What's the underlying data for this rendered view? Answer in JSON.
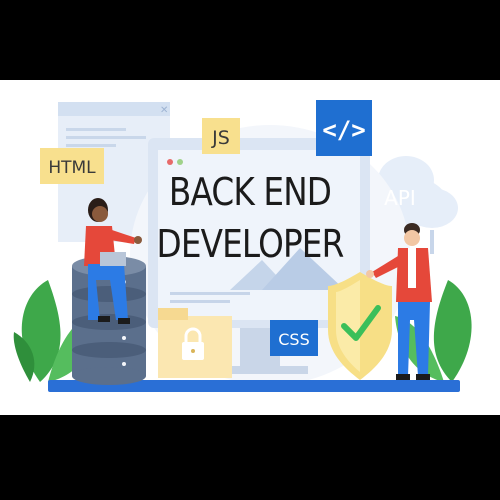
{
  "title": {
    "line1": "BACK END",
    "line2": "DEVELOPER"
  },
  "tags": {
    "html": "HTML",
    "js": "JS",
    "code": "</>",
    "api": "API",
    "css": "CSS"
  },
  "colors": {
    "page_bg": "#000000",
    "canvas_bg": "#ffffff",
    "tag_yellow": "#f8e08e",
    "tag_blue": "#1f6fd1",
    "panel_light": "#dfe8f5",
    "shield_yellow": "#f7df86",
    "check_green": "#3bbf5a",
    "plant_green": "#3ea84a",
    "floor_blue": "#2a6fd6"
  },
  "icons": {
    "code": "code-tag-icon",
    "lock": "padlock-icon",
    "shield": "shield-check-icon",
    "cloud": "cloud-icon",
    "database": "database-icon"
  }
}
